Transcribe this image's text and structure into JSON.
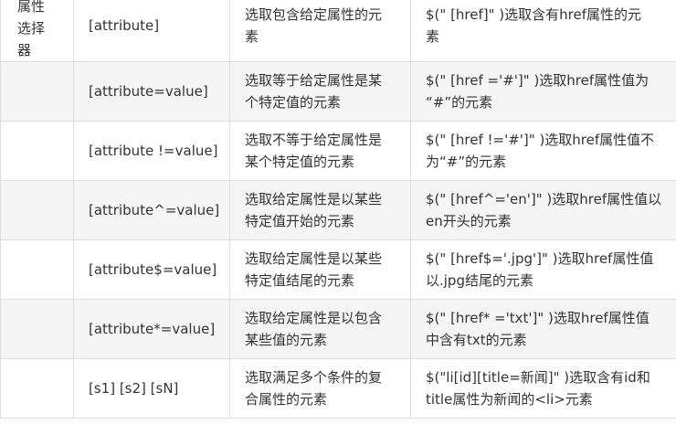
{
  "category": "属性选择器",
  "category_lines": [
    "属性",
    "选择",
    "器"
  ],
  "rows": [
    {
      "selector": "[attribute]",
      "desc": [
        "选取包含给定属性的元",
        "素"
      ],
      "example": [
        "$(\" [href]\" )选取含有href属性的元",
        "素"
      ]
    },
    {
      "selector": "[attribute=value]",
      "desc": [
        "选取等于给定属性是某",
        "个特定值的元素"
      ],
      "example": [
        "$(\" [href ='#']\" )选取href属性值为",
        "“#”的元素"
      ]
    },
    {
      "selector": "[attribute !=value]",
      "desc": [
        "选取不等于给定属性是",
        "某个特定值的元素"
      ],
      "example": [
        "$(\" [href !='#']\" )选取href属性值不",
        "为“#”的元素"
      ]
    },
    {
      "selector": "[attribute^=value]",
      "desc": [
        "选取给定属性是以某些",
        "特定值开始的元素"
      ],
      "example": [
        "$(\" [href^='en']\" )选取href属性值以",
        "en开头的元素"
      ]
    },
    {
      "selector": "[attribute$=value]",
      "desc": [
        "选取给定属性是以某些",
        "特定值结尾的元素"
      ],
      "example": [
        "$(\" [href$='.jpg']\" )选取href属性值",
        "以.jpg结尾的元素"
      ]
    },
    {
      "selector": "[attribute*=value]",
      "desc": [
        "选取给定属性是以包含",
        "某些值的元素"
      ],
      "example": [
        "$(\" [href* ='txt']\" )选取href属性值",
        "中含有txt的元素"
      ]
    },
    {
      "selector": "[s1] [s2] [sN]",
      "desc": [
        "选取满足多个条件的复",
        "合属性的元素"
      ],
      "example": [
        "$(\"li[id][title=新闻]\" )选取含有id和",
        "title属性为新闻的<li>元素"
      ]
    }
  ]
}
